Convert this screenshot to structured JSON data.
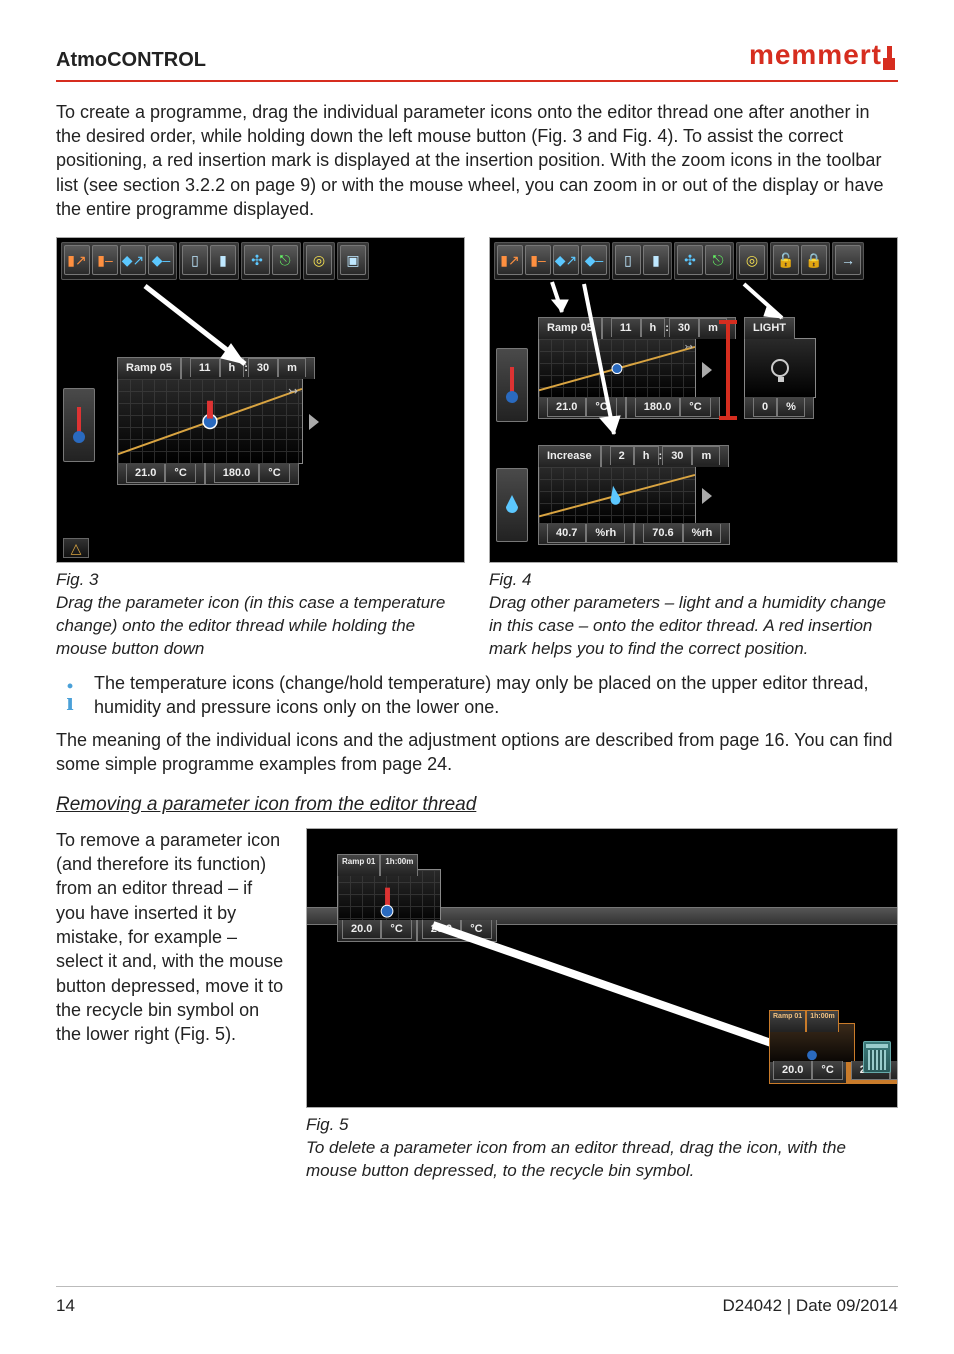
{
  "header": {
    "title": "AtmoCONTROL",
    "brand": "memmert"
  },
  "intro": "To create a programme, drag the individual parameter icons onto the editor thread one after another in the desired order, while holding down the left mouse button (Fig. 3 and Fig. 4). To assist the correct positioning, a red insertion mark is displayed at the insertion position. With the zoom icons in the toolbar list (see section 3.2.2 on page 9) or with the mouse wheel, you can zoom in or out of the display or have the entire programme displayed.",
  "fig3": {
    "label": "Fig. 3",
    "caption": "Drag the parameter icon (in this case a temperature change) onto the editor thread while holding the mouse button down",
    "block": {
      "name": "Ramp 05",
      "duration_h": "11",
      "duration_m": "30",
      "start": "21.0",
      "start_unit": "°C",
      "end": "180.0",
      "end_unit": "°C"
    }
  },
  "fig4": {
    "label": "Fig. 4",
    "caption": "Drag other parameters – light and a humidity change in this case – onto the editor thread. A red insertion mark helps you to find the correct position.",
    "temp_block": {
      "name": "Ramp 05",
      "duration_h": "11",
      "duration_m": "30",
      "start": "21.0",
      "start_unit": "°C",
      "end": "180.0",
      "end_unit": "°C"
    },
    "light_block": {
      "name": "LIGHT",
      "value": "0",
      "unit": "%"
    },
    "humid_block": {
      "name": "Increase",
      "duration_h": "2",
      "duration_m": "30",
      "start": "40.7",
      "start_unit": "%rh",
      "end": "70.6",
      "end_unit": "%rh"
    }
  },
  "info": "The temperature icons (change/hold temperature) may only be placed on the upper editor thread, humidity and pressure icons only on the lower one.",
  "meaning": "The meaning of the individual icons and the adjustment options are described from page 16. You can find some simple programme examples from page 24.",
  "remove_head": "Removing a parameter icon from the editor thread",
  "remove_text": "To remove a parameter icon (and therefore its function) from an editor thread – if you have inserted it by mistake, for example – select it and, with the mouse button depressed, move it to the recycle bin symbol on the lower right  (Fig. 5).",
  "fig5": {
    "label": "Fig. 5",
    "caption": "To delete a parameter icon from an editor thread, drag the icon, with the mouse button depressed, to the recycle bin symbol.",
    "block": {
      "name": "Ramp 01",
      "duration": "1h:00m",
      "start": "20.0",
      "start_unit": "°C",
      "end": "20.0",
      "end_unit": "°C"
    },
    "ghost": {
      "name": "Ramp 01",
      "duration": "1h:00m",
      "start": "20.0",
      "start_unit": "°C",
      "end": "20.0",
      "end_unit": "°C"
    }
  },
  "footer": {
    "page": "14",
    "docinfo": "D24042 | Date 09/2014"
  }
}
